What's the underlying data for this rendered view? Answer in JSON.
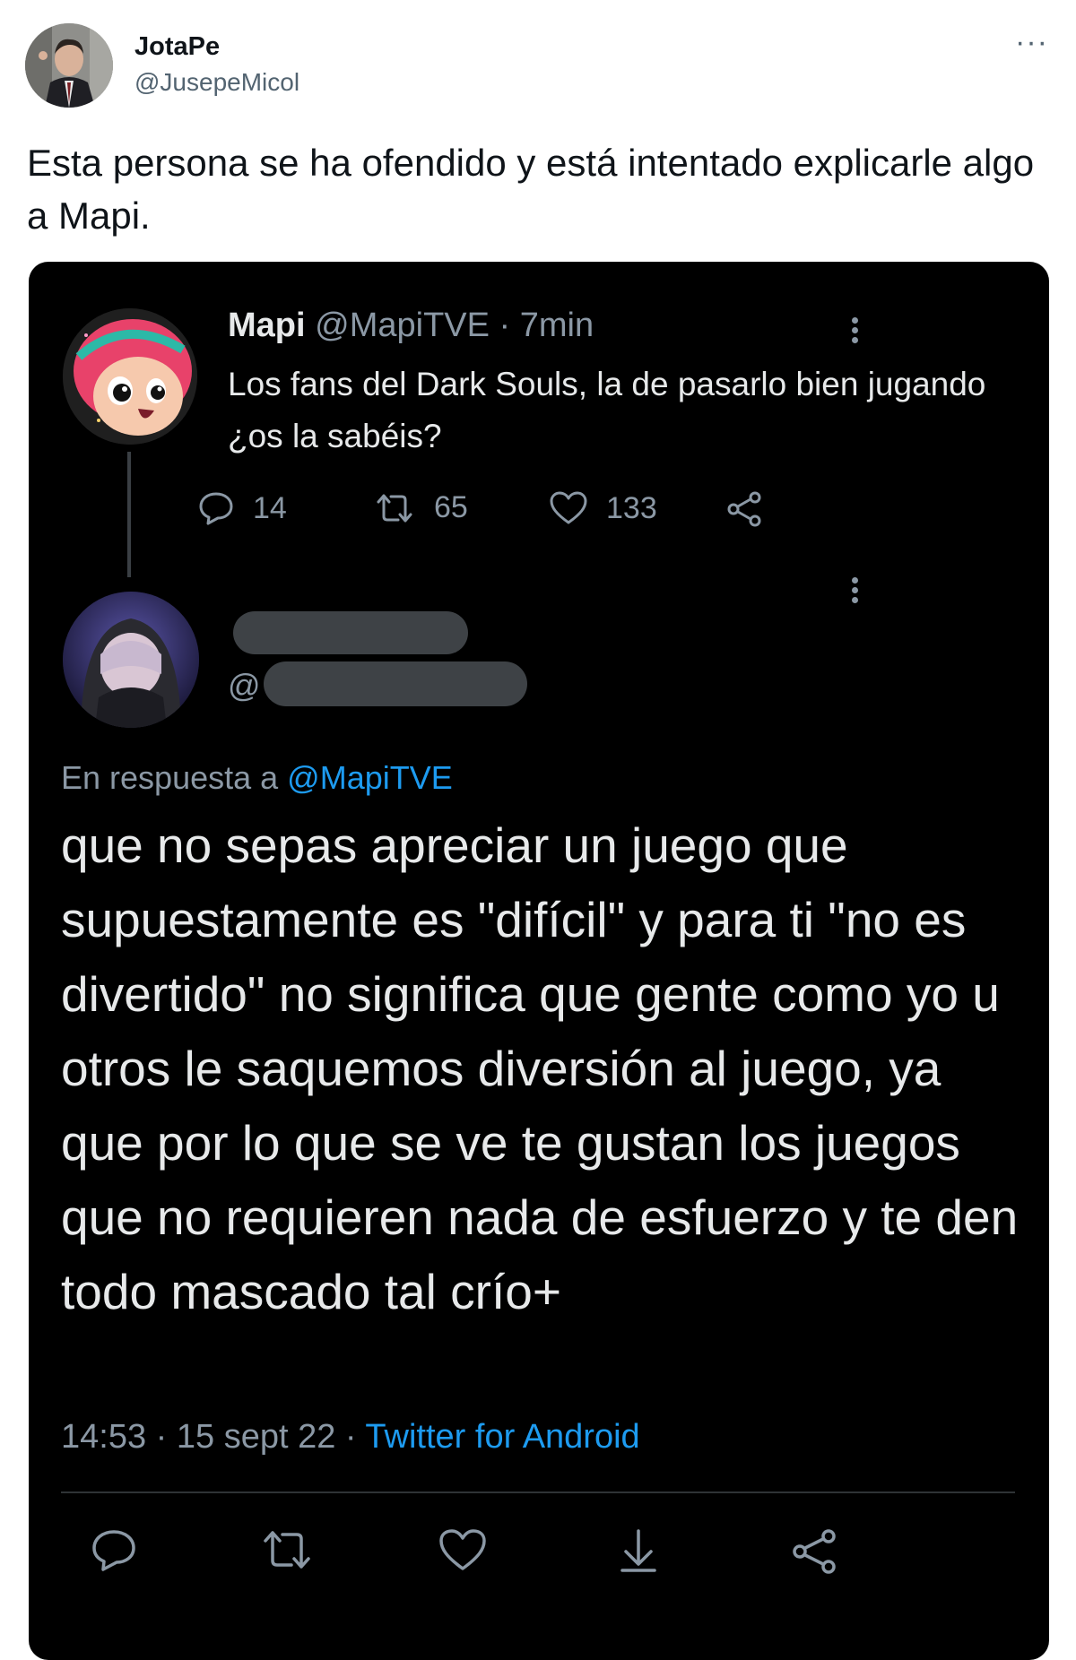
{
  "tweet": {
    "author_name": "JotaPe",
    "author_handle": "@JusepeMicol",
    "more_label": "···",
    "text": "Esta persona se ha ofendido y está intentado explicarle algo a Mapi."
  },
  "screenshot": {
    "original_tweet": {
      "name": "Mapi",
      "meta": "@MapiTVE · 7min",
      "text": "Los fans del Dark Souls, la de pasarlo bien jugando ¿os la sabéis?",
      "stats": {
        "replies": "14",
        "retweets": "65",
        "likes": "133"
      }
    },
    "reply": {
      "handle_prefix": "@",
      "reply_prefix": "En respuesta a ",
      "reply_to": "@MapiTVE",
      "text": "que no sepas apreciar un juego que supuestamente es \"difícil\" y para ti \"no es divertido\" no significa que gente como yo u otros le saquemos diversión al juego, ya que por lo que se ve te gustan los juegos que no requieren nada de esfuerzo y te den todo mascado tal crío+",
      "timestamp": "14:53 · 15 sept 22 · ",
      "source": "Twitter for Android"
    }
  },
  "colors": {
    "link_blue": "#1d9bf0",
    "dark_bg": "#000000",
    "muted_gray": "#8b98a5",
    "redaction_gray": "#3e4246"
  }
}
